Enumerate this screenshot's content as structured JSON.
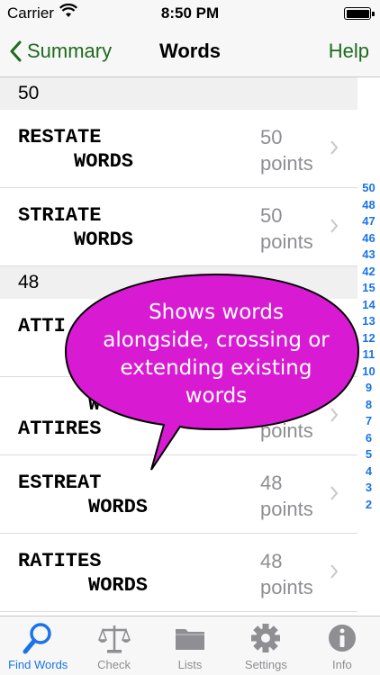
{
  "status_bar": {
    "carrier": "Carrier",
    "time": "8:50 PM"
  },
  "nav": {
    "back_label": "Summary",
    "title": "Words",
    "help_label": "Help"
  },
  "sections": [
    {
      "header": "50",
      "rows": [
        {
          "word": "RESTATE",
          "sub": "WORDS",
          "points": "50",
          "points_unit": "points"
        },
        {
          "word": "STRIATE",
          "sub": "WORDS",
          "points": "50",
          "points_unit": "points"
        }
      ]
    },
    {
      "header": "48",
      "rows": [
        {
          "word": "ATTI",
          "sub": "",
          "points": "",
          "points_unit": ""
        },
        {
          "word": "ATTIRES",
          "sub": "W",
          "points": "",
          "points_unit": "points"
        },
        {
          "word": "ESTREAT",
          "sub": "WORDS",
          "points": "48",
          "points_unit": "points"
        },
        {
          "word": "RATITES",
          "sub": "WORDS",
          "points": "48",
          "points_unit": "points"
        }
      ]
    }
  ],
  "index": [
    "50",
    "48",
    "47",
    "46",
    "43",
    "42",
    "15",
    "14",
    "13",
    "12",
    "11",
    "10",
    "9",
    "8",
    "7",
    "6",
    "5",
    "4",
    "3",
    "2"
  ],
  "callout": {
    "lines": [
      "Shows words",
      "alongside, crossing or",
      "extending existing",
      "words"
    ],
    "color": "#d81bd2"
  },
  "tabs": [
    {
      "label": "Find Words",
      "icon": "search-icon",
      "active": true
    },
    {
      "label": "Check",
      "icon": "scales-icon",
      "active": false
    },
    {
      "label": "Lists",
      "icon": "folder-icon",
      "active": false
    },
    {
      "label": "Settings",
      "icon": "gear-icon",
      "active": false
    },
    {
      "label": "Info",
      "icon": "info-icon",
      "active": false
    }
  ],
  "colors": {
    "accent_green": "#1e6b1e",
    "accent_blue": "#1a73e8",
    "muted": "#8e8e93"
  }
}
